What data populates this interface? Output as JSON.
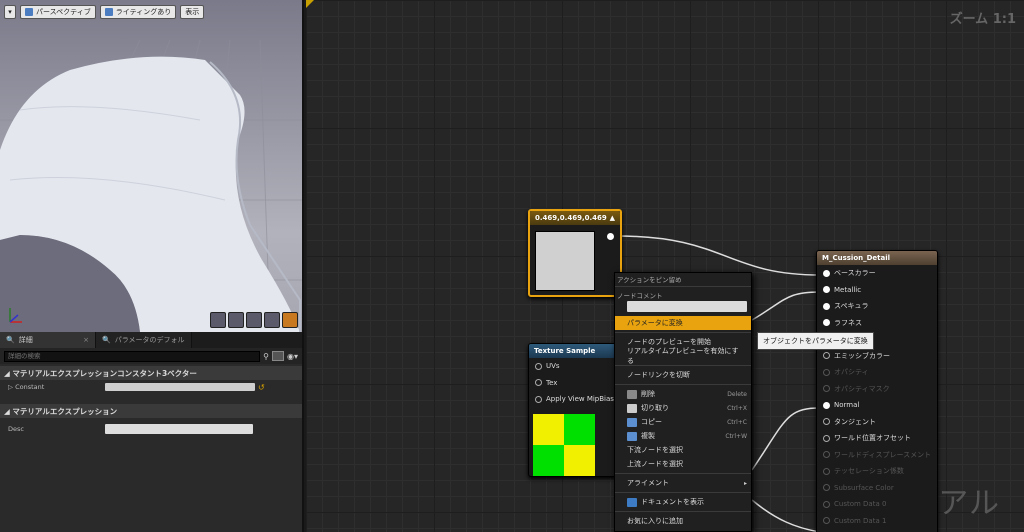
{
  "viewport": {
    "perspective_label": "パースペクティブ",
    "lighting_label": "ライティングあり",
    "show_label": "表示"
  },
  "details": {
    "tabs": [
      {
        "label": "詳細"
      },
      {
        "label": "パラメータのデフォル"
      }
    ],
    "search_placeholder": "詳細の検索",
    "section1_title": "マテリアルエクスプレッションコンスタント3ベクター",
    "constant_label": "Constant",
    "section2_title": "マテリアルエクスプレッション",
    "desc_label": "Desc"
  },
  "graph": {
    "zoom": "ズーム 1:1",
    "watermark": "マテリアル",
    "const_node": {
      "title": "0.469,0.469,0.469",
      "color": "#d0d0d0"
    },
    "texture_node": {
      "title": "Texture Sample",
      "pins": [
        "UVs",
        "Tex",
        "Apply View MipBias"
      ]
    },
    "material_node": {
      "title": "M_Cussion_Detail",
      "pins": [
        {
          "label": "ベースカラー",
          "on": true
        },
        {
          "label": "Metallic",
          "on": true
        },
        {
          "label": "スペキュラ",
          "on": true
        },
        {
          "label": "ラフネス",
          "on": true
        },
        {
          "label": "",
          "on": false
        },
        {
          "label": "エミッシブカラー",
          "on": false
        },
        {
          "label": "オパシティ",
          "on": false,
          "disabled": true
        },
        {
          "label": "オパシティマスク",
          "on": false,
          "disabled": true
        },
        {
          "label": "Normal",
          "on": true
        },
        {
          "label": "タンジェント",
          "on": false
        },
        {
          "label": "ワールド位置オフセット",
          "on": false
        },
        {
          "label": "ワールドディスプレースメント",
          "on": false,
          "disabled": true
        },
        {
          "label": "テッセレーション係数",
          "on": false,
          "disabled": true
        },
        {
          "label": "Subsurface Color",
          "on": false,
          "disabled": true
        },
        {
          "label": "Custom Data 0",
          "on": false,
          "disabled": true
        },
        {
          "label": "Custom Data 1",
          "on": false,
          "disabled": true
        }
      ]
    }
  },
  "context_menu": {
    "header_pin": "アクションをピン留め",
    "header_comment": "ノードコメント",
    "items": {
      "convert_param": "パラメータに変換",
      "start_preview": "ノードのプレビューを開始",
      "enable_realtime": "リアルタイムプレビューを有効にする",
      "break_links": "ノードリンクを切断",
      "delete": "削除",
      "cut": "切り取り",
      "copy": "コピー",
      "duplicate": "複製",
      "select_down": "下流ノードを選択",
      "select_up": "上流ノードを選択",
      "alignment": "アライメント",
      "show_doc": "ドキュメントを表示",
      "add_favorite": "お気に入りに追加"
    },
    "shortcuts": {
      "delete": "Delete",
      "cut": "Ctrl+X",
      "copy": "Ctrl+C",
      "duplicate": "Ctrl+W"
    }
  },
  "tooltip": "オブジェクトをパラメータに変換"
}
